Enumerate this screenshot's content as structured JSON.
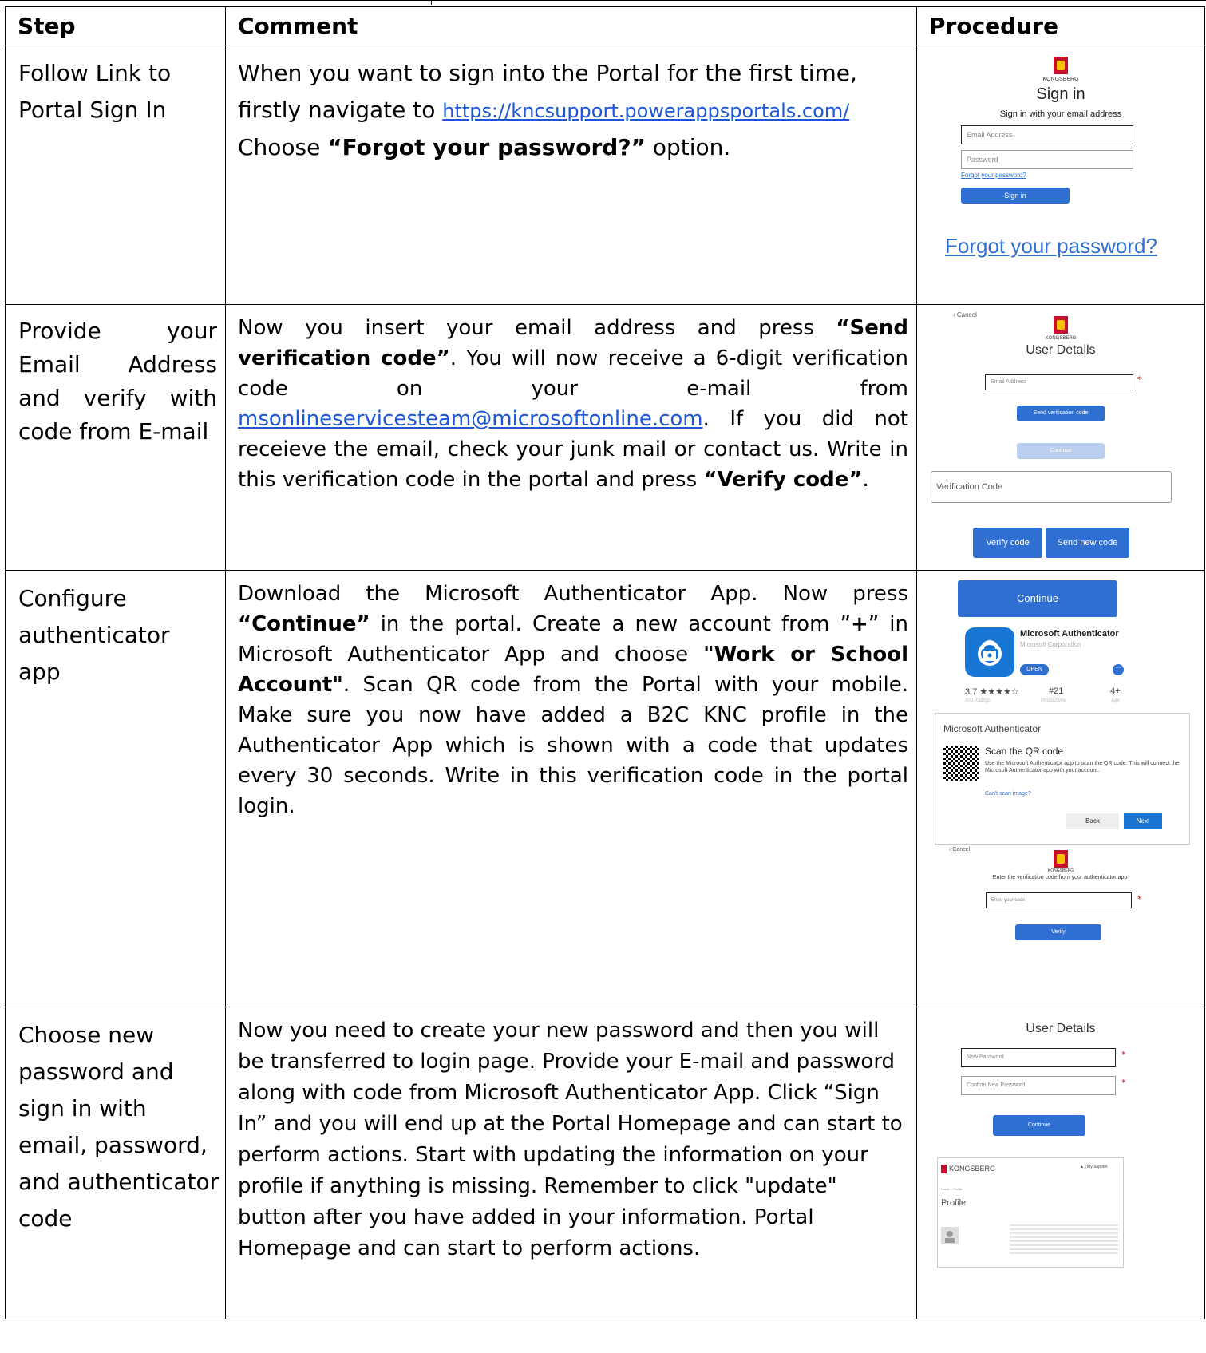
{
  "table": {
    "headers": {
      "step": "Step",
      "comment": "Comment",
      "procedure": "Procedure"
    },
    "rows": [
      {
        "step": "Follow Link to Portal Sign In",
        "comment": {
          "t1": "When you want to sign into the Portal for the first time, firstly navigate to ",
          "link": "https://kncsupport.powerappsportals.com/",
          "t2": " Choose ",
          "b1": "“Forgot your password?”",
          "t3": " option."
        },
        "procedure": {
          "brand": "KONGSBERG",
          "title": "Sign in",
          "subtitle": "Sign in with your email address",
          "email_placeholder": "Email Address",
          "password_placeholder": "Password",
          "forgot_small": "Forgot your password?",
          "signin_button": "Sign in",
          "forgot_large": "Forgot your password?"
        }
      },
      {
        "step": "Provide your Email Address and verify with code from E-mail",
        "comment": {
          "t1": "Now you insert your email address and press ",
          "b1": "“Send verification code”",
          "t2": ". You will now receive a 6-digit verification code on your e-mail from ",
          "link": "msonlineservicesteam@microsoftonline.com",
          "t3": ". If you did not receieve the email, check your junk mail or contact us. Write in this verification code in the portal and press ",
          "b2": "“Verify code”",
          "t4": "."
        },
        "procedure": {
          "cancel": "Cancel",
          "brand": "KONGSBERG",
          "title": "User Details",
          "email_placeholder": "Email Address",
          "send_button": "Send verification code",
          "continue_button": "Continue",
          "code_placeholder": "Verification Code",
          "verify_button": "Verify code",
          "send_new_button": "Send new code"
        }
      },
      {
        "step": "Configure authenticator app",
        "comment": {
          "t1": "Download the Microsoft Authenticator App.  Now press ",
          "b1": "“Continue”",
          "t2": " in the portal. Create a new account from ”",
          "b2": "+",
          "t3": "” in Microsoft Authenticator App and choose ",
          "b3": "\"Work or School Account\"",
          "t4": ". Scan QR code from the Portal with your mobile. Make sure you now have added a B2C KNC profile in the Authenticator App which is shown with a code that updates every 30 seconds. Write in this verification code in the portal login."
        },
        "procedure": {
          "continue_button": "Continue",
          "app_name": "Microsoft Authenticator",
          "app_publisher": "Microsoft Corporation",
          "open_button": "OPEN",
          "rating": "3.7 ★★★★☆",
          "rating_sub": "300 Ratings",
          "rank": "#21",
          "rank_sub": "Productivity",
          "age": "4+",
          "age_sub": "Age",
          "dialog_title": "Microsoft Authenticator",
          "scan_title": "Scan the QR code",
          "scan_text": "Use the Microsoft Authenticator app to scan the QR code. This will connect the Microsoft Authenticator app with your account.",
          "cant_scan": "Can't scan image?",
          "back_button": "Back",
          "next_button": "Next",
          "cancel": "Cancel",
          "brand": "KONGSBERG",
          "enter_code_label": "Enter the verification code from your authenticator app.",
          "code_placeholder": "Enter your code",
          "verify_button": "Verify"
        }
      },
      {
        "step": "Choose new password and sign in with email, password, and authenticator code",
        "comment": {
          "t1": "Now you need to create your new password and then you will be transferred to login page. Provide your E-mail and password along with code from Microsoft Authenticator App. Click “Sign In” and you will end up at the Portal Homepage and can start to perform actions. Start with updating the information on your profile if anything is missing. Remember to click \"update\" button after you have added in your information. Portal Homepage and can start to perform actions."
        },
        "procedure": {
          "title": "User Details",
          "new_password": "New Password",
          "confirm_password": "Confirm New Password",
          "continue_button": "Continue",
          "brand": "KONGSBERG",
          "nav_support": "My Support",
          "breadcrumb": "Home > Profile",
          "profile_title": "Profile"
        }
      }
    ]
  }
}
